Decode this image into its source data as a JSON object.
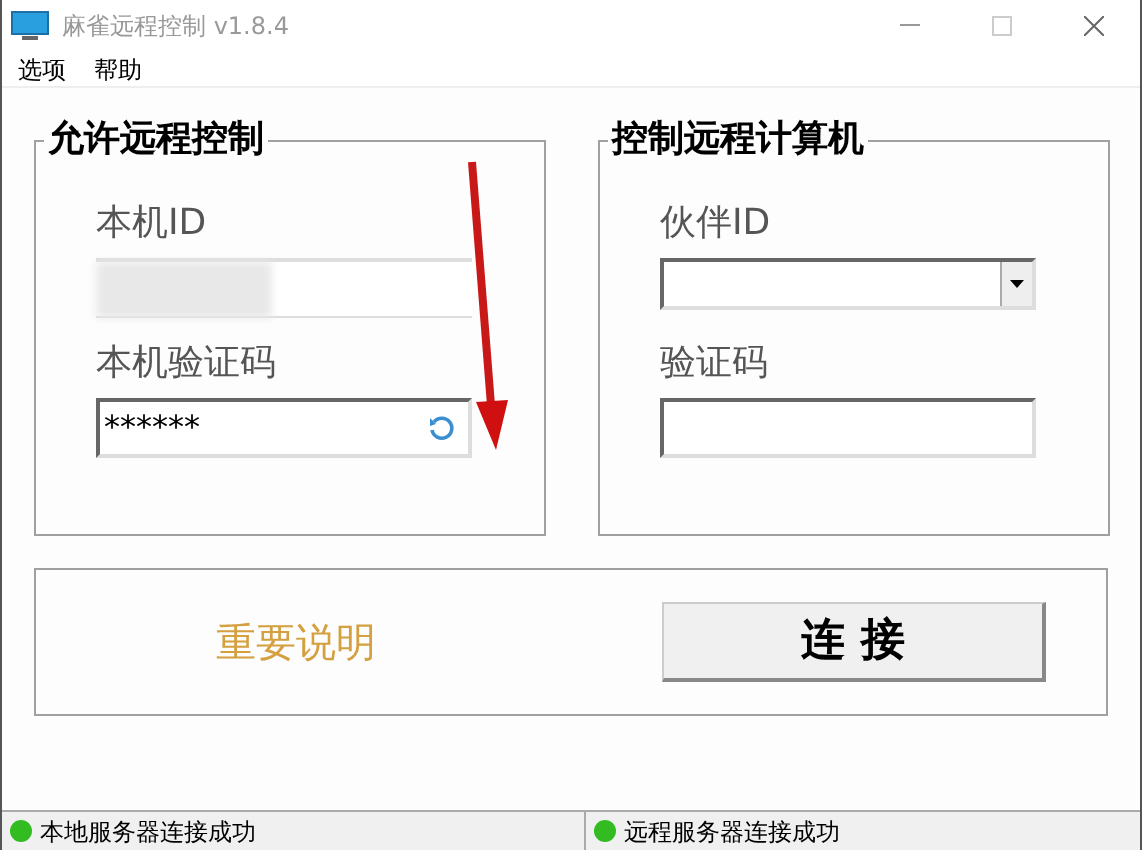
{
  "window": {
    "title": "麻雀远程控制 v1.8.4"
  },
  "menu": [
    "选项",
    "帮助"
  ],
  "allow_group": {
    "title": "允许远程控制",
    "id_label": "本机ID",
    "code_label": "本机验证码",
    "code_value": "******"
  },
  "control_group": {
    "title": "控制远程计算机",
    "partner_label": "伙伴ID",
    "code_label": "验证码"
  },
  "notice_link": "重要说明",
  "connect_button": "连 接",
  "status_bar": [
    {
      "text": "本地服务器连接成功",
      "color": "#33bb22"
    },
    {
      "text": "远程服务器连接成功",
      "color": "#33bb22"
    }
  ]
}
